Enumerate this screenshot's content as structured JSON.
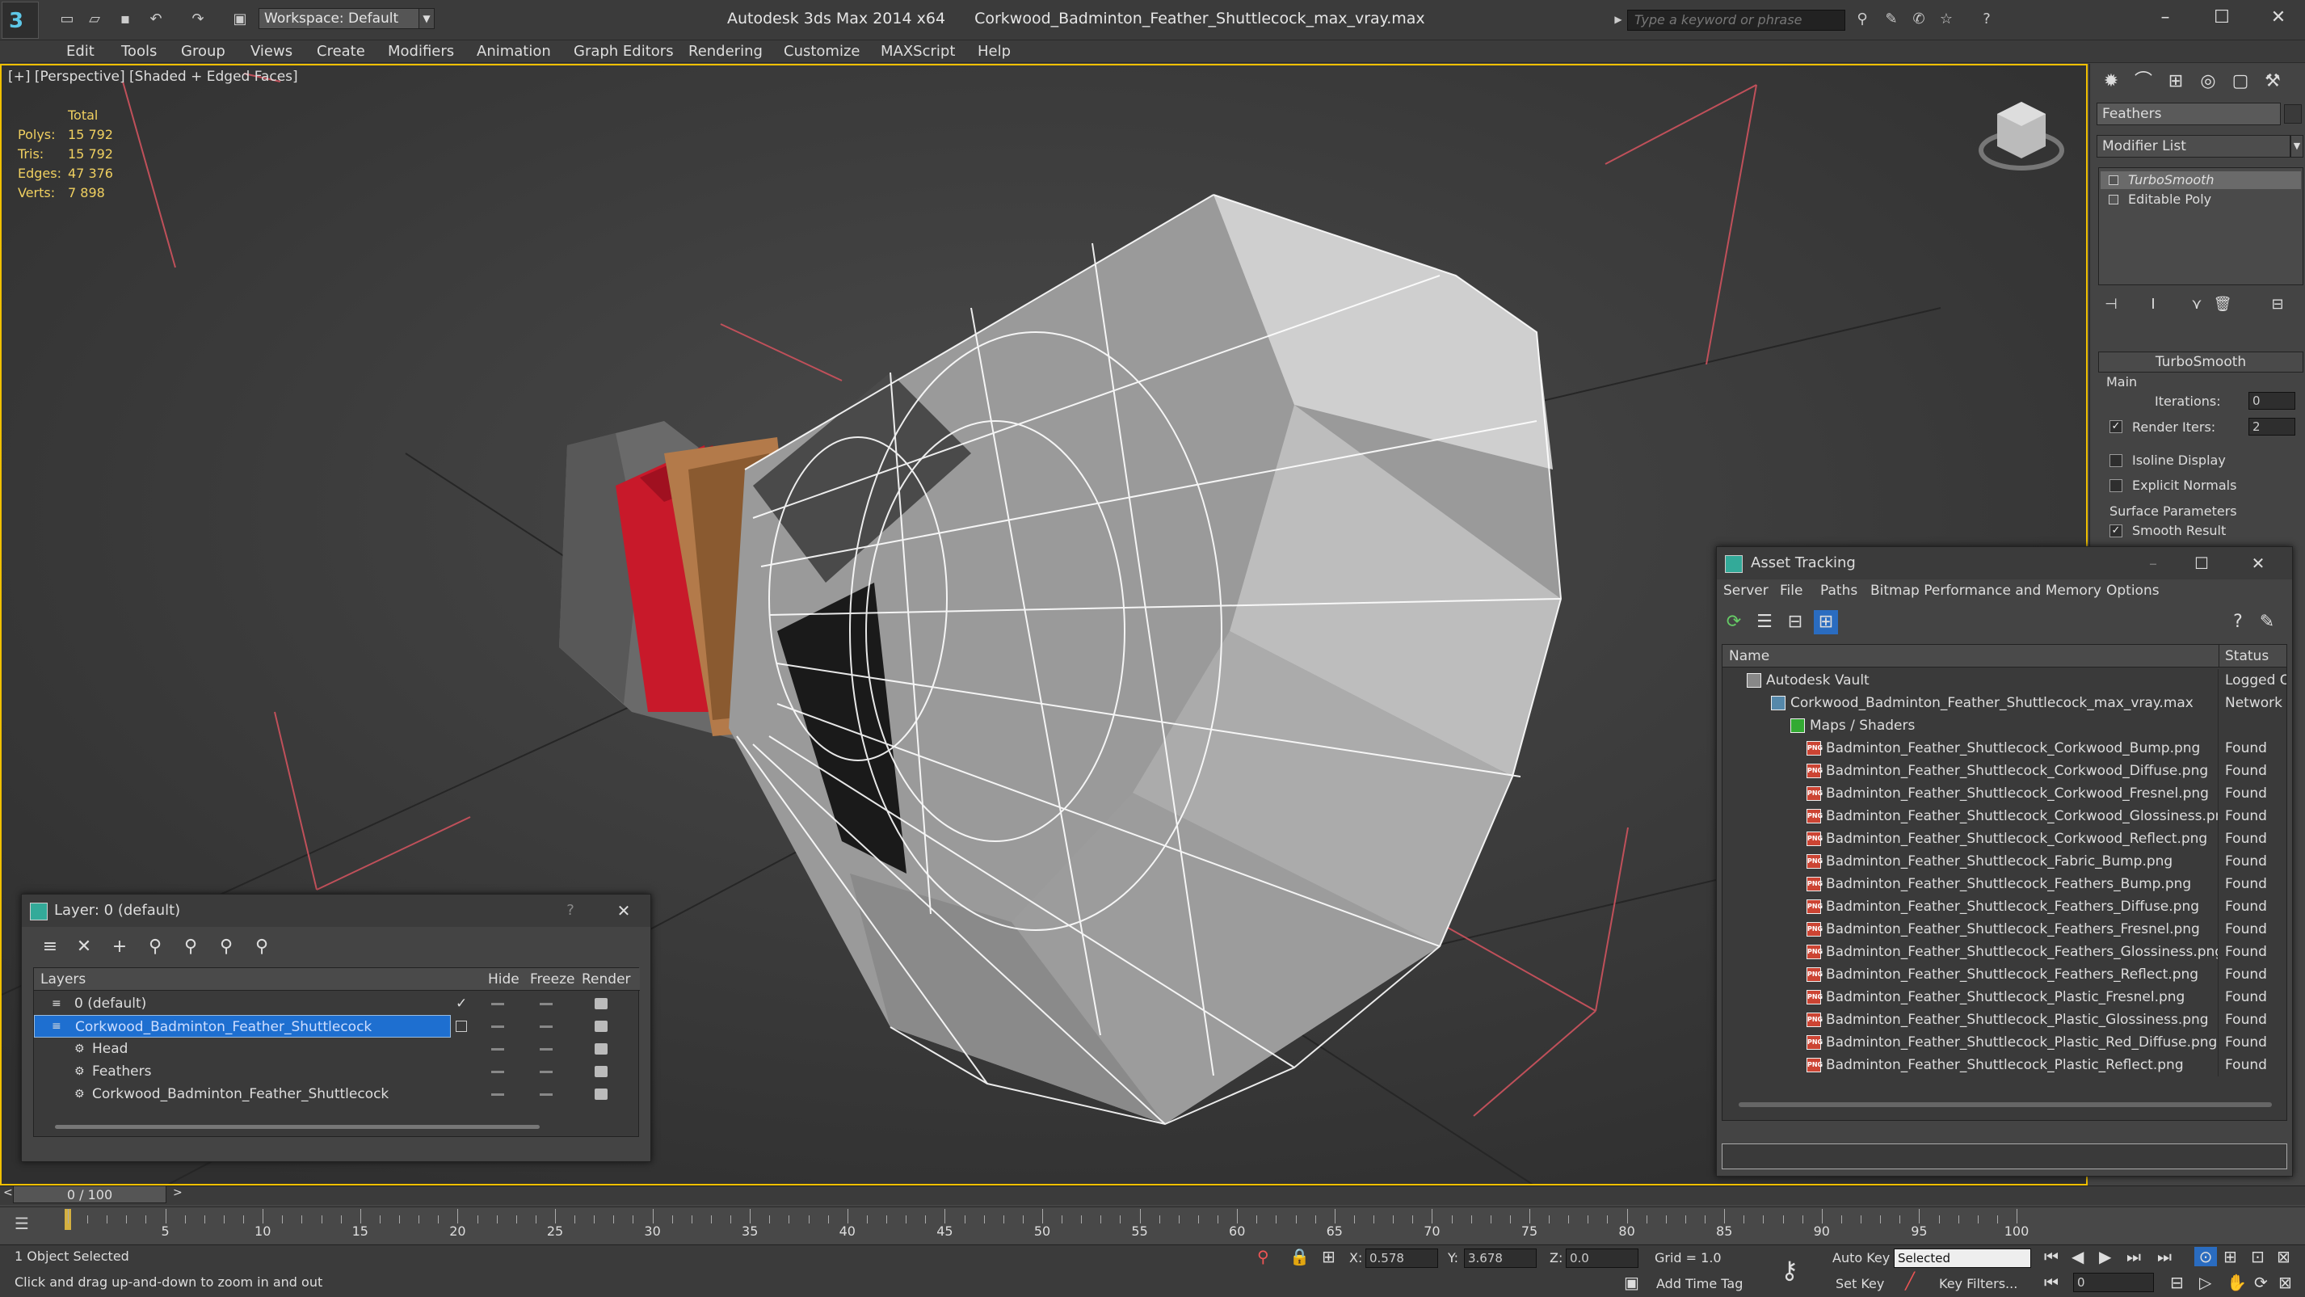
{
  "titlebar": {
    "app_title": "Autodesk 3ds Max  2014 x64",
    "file_title": "Corkwood_Badminton_Feather_Shuttlecock_max_vray.max",
    "workspace": "Workspace: Default",
    "search_placeholder": "Type a keyword or phrase"
  },
  "menu": [
    "Edit",
    "Tools",
    "Group",
    "Views",
    "Create",
    "Modifiers",
    "Animation",
    "Graph Editors",
    "Rendering",
    "Customize",
    "MAXScript",
    "Help"
  ],
  "viewport": {
    "label": "[+] [Perspective] [Shaded + Edged Faces]",
    "stats": {
      "header": "Total",
      "rows": [
        {
          "k": "Polys:",
          "v": "15 792"
        },
        {
          "k": "Tris:",
          "v": "15 792"
        },
        {
          "k": "Edges:",
          "v": "47 376"
        },
        {
          "k": "Verts:",
          "v": "7 898"
        }
      ]
    }
  },
  "command_panel": {
    "object_name": "Feathers",
    "modifier_list": "Modifier List",
    "stack": [
      "TurboSmooth",
      "Editable Poly"
    ],
    "turbosmooth": {
      "title": "TurboSmooth",
      "main": "Main",
      "iterations_label": "Iterations:",
      "iterations": "0",
      "render_iters_label": "Render Iters:",
      "render_iters": "2",
      "isoline": "Isoline Display",
      "explicit": "Explicit Normals",
      "surface": "Surface Parameters",
      "smooth": "Smooth Result"
    }
  },
  "asset_tracking": {
    "title": "Asset Tracking",
    "menu": [
      "Server",
      "File",
      "Paths",
      "Bitmap Performance and Memory",
      "Options"
    ],
    "columns": {
      "name": "Name",
      "status": "Status"
    },
    "vault": {
      "name": "Autodesk Vault",
      "status": "Logged O"
    },
    "file": {
      "name": "Corkwood_Badminton_Feather_Shuttlecock_max_vray.max",
      "status": "Network P"
    },
    "maps": {
      "name": "Maps / Shaders"
    },
    "files": [
      {
        "name": "Badminton_Feather_Shuttlecock_Corkwood_Bump.png",
        "status": "Found"
      },
      {
        "name": "Badminton_Feather_Shuttlecock_Corkwood_Diffuse.png",
        "status": "Found"
      },
      {
        "name": "Badminton_Feather_Shuttlecock_Corkwood_Fresnel.png",
        "status": "Found"
      },
      {
        "name": "Badminton_Feather_Shuttlecock_Corkwood_Glossiness.png",
        "status": "Found"
      },
      {
        "name": "Badminton_Feather_Shuttlecock_Corkwood_Reflect.png",
        "status": "Found"
      },
      {
        "name": "Badminton_Feather_Shuttlecock_Fabric_Bump.png",
        "status": "Found"
      },
      {
        "name": "Badminton_Feather_Shuttlecock_Feathers_Bump.png",
        "status": "Found"
      },
      {
        "name": "Badminton_Feather_Shuttlecock_Feathers_Diffuse.png",
        "status": "Found"
      },
      {
        "name": "Badminton_Feather_Shuttlecock_Feathers_Fresnel.png",
        "status": "Found"
      },
      {
        "name": "Badminton_Feather_Shuttlecock_Feathers_Glossiness.png",
        "status": "Found"
      },
      {
        "name": "Badminton_Feather_Shuttlecock_Feathers_Reflect.png",
        "status": "Found"
      },
      {
        "name": "Badminton_Feather_Shuttlecock_Plastic_Fresnel.png",
        "status": "Found"
      },
      {
        "name": "Badminton_Feather_Shuttlecock_Plastic_Glossiness.png",
        "status": "Found"
      },
      {
        "name": "Badminton_Feather_Shuttlecock_Plastic_Red_Diffuse.png",
        "status": "Found"
      },
      {
        "name": "Badminton_Feather_Shuttlecock_Plastic_Reflect.png",
        "status": "Found"
      }
    ]
  },
  "layer_panel": {
    "title": "Layer: 0 (default)",
    "help": "?",
    "columns": {
      "layers": "Layers",
      "hide": "Hide",
      "freeze": "Freeze",
      "render": "Render"
    },
    "rows": [
      "0 (default)",
      "Corkwood_Badminton_Feather_Shuttlecock",
      "Head",
      "Feathers",
      "Corkwood_Badminton_Feather_Shuttlecock"
    ]
  },
  "timeline": {
    "frame": "0 / 100",
    "ticks": [
      "5",
      "10",
      "15",
      "20",
      "25",
      "30",
      "35",
      "40",
      "45",
      "50",
      "55",
      "60",
      "65",
      "70",
      "75",
      "80",
      "85",
      "90",
      "95",
      "100"
    ]
  },
  "status": {
    "selected": "1 Object Selected",
    "hint": "Click and drag up-and-down to zoom in and out",
    "x_label": "X:",
    "x": "0.578",
    "y_label": "Y:",
    "y": "3.678",
    "z_label": "Z:",
    "z": "0.0",
    "grid": "Grid = 1.0",
    "auto_key": "Auto Key",
    "set_key": "Set Key",
    "key_mode": "Selected",
    "key_filters": "Key Filters...",
    "add_time_tag": "Add Time Tag",
    "frame_field": "0"
  },
  "colors": {
    "accent": "#1e6fd0",
    "stats": "#f0d060",
    "viewport_border": "#f0c000",
    "red_band": "#c8192a"
  }
}
